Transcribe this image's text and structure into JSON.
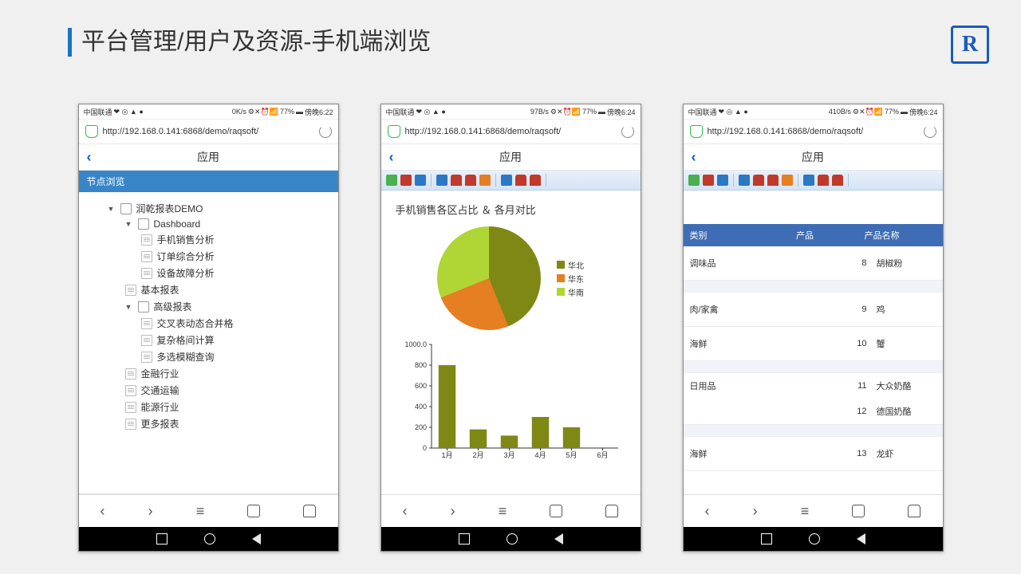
{
  "slide": {
    "title": "平台管理/用户及资源-手机端浏览",
    "logo_text": "R"
  },
  "common": {
    "carrier": "中国联通",
    "battery": "77%",
    "url": "http://192.168.0.141:6868/demo/raqsoft/",
    "app_title": "应用"
  },
  "phone1": {
    "net": "0K/s",
    "time": "傍晚6:22",
    "tree_header": "节点浏览",
    "tree": {
      "root": "润乾报表DEMO",
      "dashboard": "Dashboard",
      "dash_items": [
        "手机销售分析",
        "订单综合分析",
        "设备故障分析"
      ],
      "basic": "基本报表",
      "advanced": "高级报表",
      "adv_items": [
        "交叉表动态合并格",
        "复杂格间计算",
        "多选模糊查询"
      ],
      "others": [
        "金融行业",
        "交通运输",
        "能源行业",
        "更多报表"
      ]
    }
  },
  "phone2": {
    "net": "97B/s",
    "time": "傍晚6:24",
    "chart_title": "手机销售各区占比 ＆ 各月对比"
  },
  "phone3": {
    "net": "410B/s",
    "time": "傍晚6:24",
    "headers": [
      "类别",
      "产品",
      "产品名称"
    ],
    "rows": [
      {
        "cat": "调味品",
        "pid": "8",
        "name": "胡椒粉"
      },
      {
        "cat": "肉/家禽",
        "pid": "9",
        "name": "鸡"
      },
      {
        "cat": "海鲜",
        "pid": "10",
        "name": "蟹"
      },
      {
        "cat": "日用品",
        "pid": "11",
        "name": "大众奶酪"
      },
      {
        "cat": "",
        "pid": "12",
        "name": "德国奶酪"
      },
      {
        "cat": "海鲜",
        "pid": "13",
        "name": "龙虾"
      }
    ]
  },
  "chart_data": [
    {
      "type": "pie",
      "title": "手机销售各区占比",
      "series": [
        {
          "name": "华北",
          "value": 44,
          "color": "#7f8814"
        },
        {
          "name": "华东",
          "value": 25,
          "color": "#e67e22"
        },
        {
          "name": "华南",
          "value": 31,
          "color": "#b0d636"
        }
      ]
    },
    {
      "type": "bar",
      "title": "各月对比",
      "categories": [
        "1月",
        "2月",
        "3月",
        "4月",
        "5月",
        "6月"
      ],
      "values": [
        800,
        180,
        120,
        300,
        200,
        0
      ],
      "ylabel": "",
      "ylim": [
        0,
        1000
      ],
      "yticks": [
        0,
        200,
        400,
        600,
        800,
        1000.0
      ],
      "color": "#7f8814"
    }
  ]
}
